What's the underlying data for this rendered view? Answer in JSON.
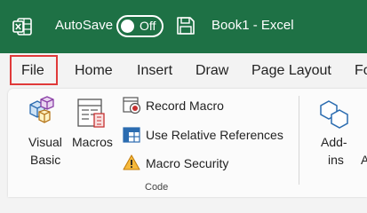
{
  "titlebar": {
    "app_icon": "excel-icon",
    "autosave_label": "AutoSave",
    "autosave_state": "Off",
    "save_icon": "save-icon",
    "document_title": "Book1  -  Excel"
  },
  "tabs": [
    {
      "label": "File",
      "highlighted": true
    },
    {
      "label": "Home"
    },
    {
      "label": "Insert"
    },
    {
      "label": "Draw"
    },
    {
      "label": "Page Layout"
    },
    {
      "label": "Fo"
    }
  ],
  "ribbon": {
    "visual_basic": {
      "line1": "Visual",
      "line2": "Basic",
      "icon": "visual-basic-icon"
    },
    "macros": {
      "label": "Macros",
      "icon": "macros-icon"
    },
    "record_macro": {
      "label": "Record Macro",
      "icon": "record-macro-icon"
    },
    "relative_refs": {
      "label": "Use Relative References",
      "icon": "relative-references-icon"
    },
    "macro_security": {
      "label": "Macro Security",
      "icon": "warning-icon"
    },
    "group_label": "Code",
    "addins": {
      "line1": "Add-",
      "line2": "ins",
      "icon": "add-ins-icon"
    },
    "partial": {
      "line2": "A"
    }
  },
  "colors": {
    "titlebar_bg": "#1e7145",
    "file_highlight": "#e03a3a",
    "ribbon_bg": "#fbfbfb"
  }
}
